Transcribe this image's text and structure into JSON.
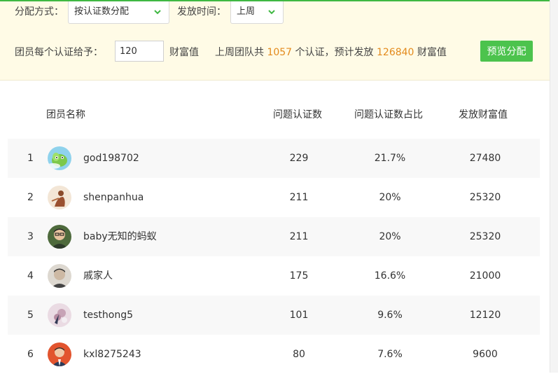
{
  "filters": {
    "method_label": "分配方式：",
    "method_value": "按认证数分配",
    "time_label": "发放时间：",
    "time_value": "上周"
  },
  "allocation": {
    "per_label": "团员每个认证给予：",
    "per_value": "120",
    "per_unit": "财富值",
    "summary_prefix": "上周团队共",
    "summary_count": "1057",
    "summary_mid": "个认证，预计发放",
    "summary_total": "126840",
    "summary_unit": "财富值",
    "preview_button": "预览分配"
  },
  "table": {
    "headers": {
      "name": "团员名称",
      "count": "问题认证数",
      "ratio": "问题认证数占比",
      "wealth": "发放财富值"
    },
    "rows": [
      {
        "index": "1",
        "name": "god198702",
        "count": "229",
        "ratio": "21.7%",
        "wealth": "27480"
      },
      {
        "index": "2",
        "name": "shenpanhua",
        "count": "211",
        "ratio": "20%",
        "wealth": "25320"
      },
      {
        "index": "3",
        "name": "baby无知的蚂蚁",
        "count": "211",
        "ratio": "20%",
        "wealth": "25320"
      },
      {
        "index": "4",
        "name": "戚家人",
        "count": "175",
        "ratio": "16.6%",
        "wealth": "21000"
      },
      {
        "index": "5",
        "name": "testhong5",
        "count": "101",
        "ratio": "9.6%",
        "wealth": "12120"
      },
      {
        "index": "6",
        "name": "kxl8275243",
        "count": "80",
        "ratio": "7.6%",
        "wealth": "9600"
      }
    ]
  },
  "colors": {
    "accent": "#4cc34d",
    "highlight": "#e38a1c",
    "panel_bg": "#fffbe6"
  }
}
